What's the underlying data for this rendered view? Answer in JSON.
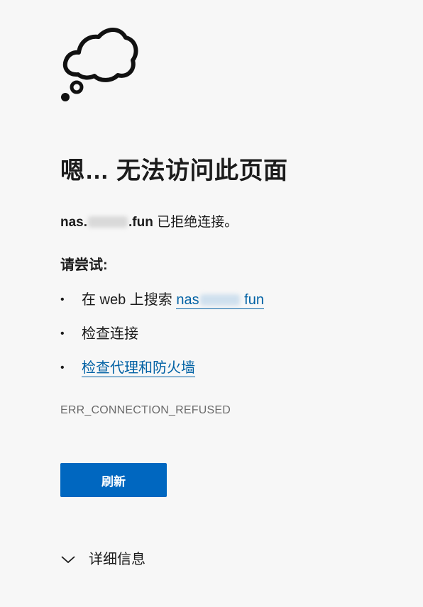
{
  "icon": {
    "name": "thought-bubble-icon"
  },
  "title": "嗯… 无法访问此页面",
  "refused": {
    "host_prefix": "nas.",
    "host_suffix": ".fun",
    "message": " 已拒绝连接。"
  },
  "try_heading": "请尝试:",
  "suggestions": {
    "search": {
      "prefix": "在 web 上搜索 ",
      "link_prefix": "nas",
      "link_suffix": " fun"
    },
    "check_connection": "检查连接",
    "check_proxy": "检查代理和防火墙"
  },
  "error_code": "ERR_CONNECTION_REFUSED",
  "refresh_button": "刷新",
  "details_label": "详细信息",
  "colors": {
    "background": "#f7f7f7",
    "accent": "#0067c0",
    "link": "#0061a4",
    "error_code": "#6b6b6b"
  }
}
